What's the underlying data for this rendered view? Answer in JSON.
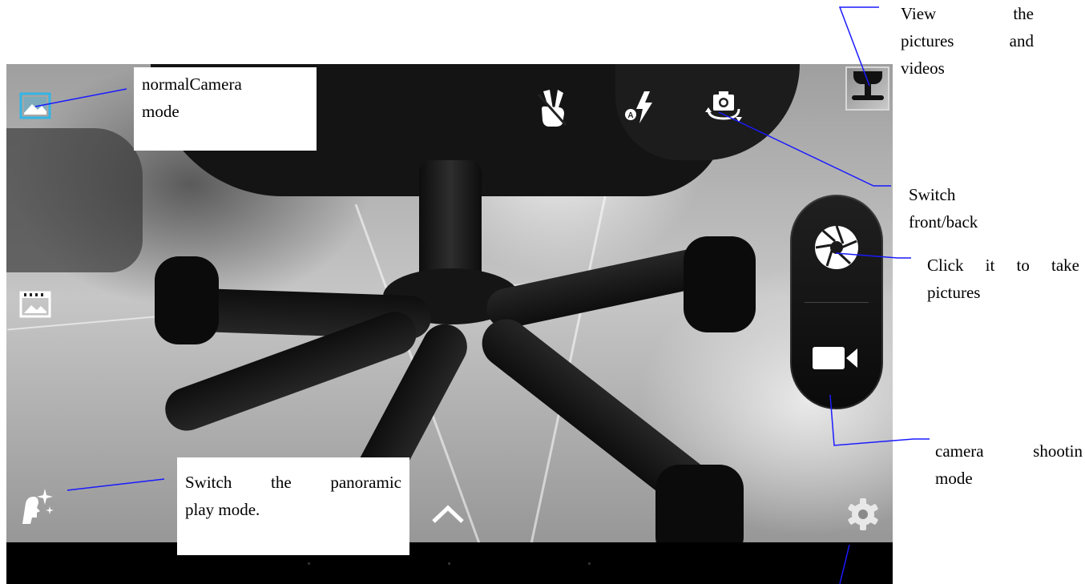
{
  "annotations": {
    "normal_camera": [
      "normalCamera",
      "mode"
    ],
    "view_pictures": [
      "View the",
      "pictures and",
      "videos"
    ],
    "switch_camera": [
      "Switch",
      "front/back"
    ],
    "take_pictures": [
      "Click it to take",
      "pictures"
    ],
    "shooting_mode": [
      "camera shootin",
      "mode"
    ],
    "panoramic": [
      "Switch the panoramic",
      "play mode."
    ]
  },
  "icons": {
    "camera_mode": "image-icon",
    "video_mode": "film-frame-icon",
    "gesture": "peace-hand-icon",
    "flash": "auto-flash-icon",
    "switch_camera": "camera-rotate-icon",
    "thumbnail": "gallery-thumbnail",
    "shutter": "aperture-shutter-icon",
    "video_record": "video-camera-icon",
    "effects": "face-sparkle-icon",
    "expand": "chevron-up-icon",
    "settings": "gear-icon"
  },
  "colors": {
    "accent": "#33b5e5",
    "callout_line": "#1a1aff",
    "navbar": "#000000"
  }
}
